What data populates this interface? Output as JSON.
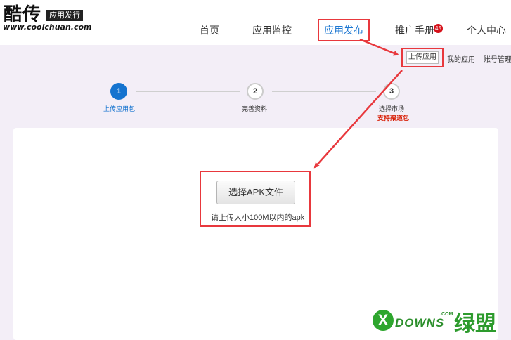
{
  "logo": {
    "title": "酷传",
    "tag": "应用发行",
    "url": "www.coolchuan.com"
  },
  "nav": {
    "home": "首页",
    "monitor": "应用监控",
    "publish": "应用发布",
    "manual": "推广手册",
    "manual_badge": "45",
    "personal": "个人中心"
  },
  "subnav": {
    "upload": "上传应用",
    "my_apps": "我的应用",
    "account": "账号管理"
  },
  "steps": [
    {
      "num": "1",
      "label": "上传应用包"
    },
    {
      "num": "2",
      "label": "完善资料"
    },
    {
      "num": "3",
      "label": "选择市场",
      "note": "支持渠道包"
    }
  ],
  "upload": {
    "button": "选择APK文件",
    "hint": "请上传大小100M以内的apk"
  },
  "watermark": {
    "brand": "DOWNS",
    "suffix": ".COM",
    "cn": "绿盟"
  },
  "colors": {
    "accent": "#1473cf",
    "highlight": "#e8383d",
    "background": "#f3eef7",
    "watermark": "#2d9b2d"
  }
}
